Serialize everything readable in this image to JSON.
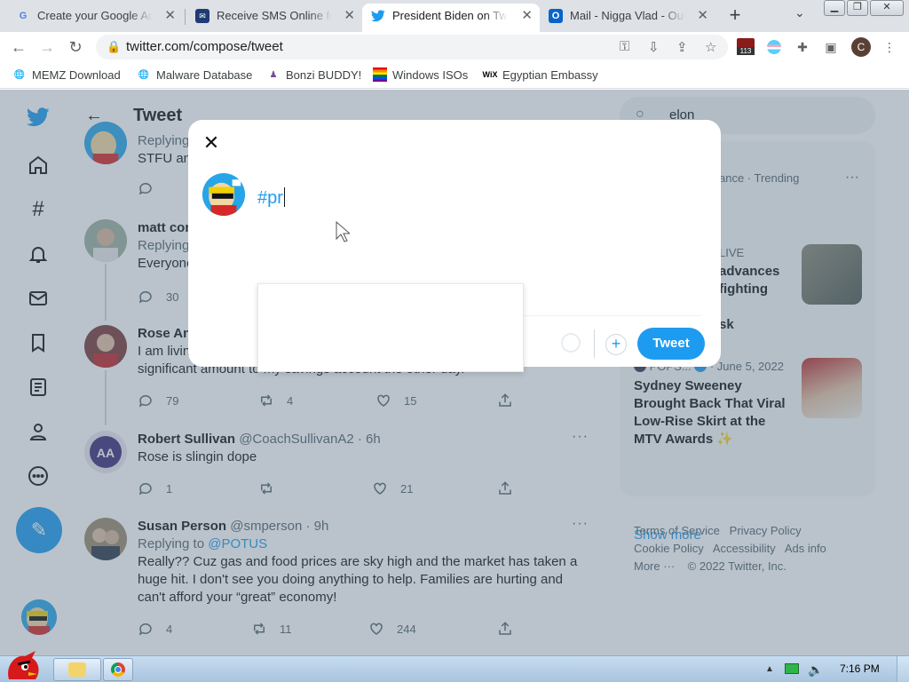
{
  "browser": {
    "tabs": [
      {
        "title": "Create your Google Acc",
        "favicon": "G"
      },
      {
        "title": "Receive SMS Online for",
        "favicon": "sms"
      },
      {
        "title": "President Biden on Twit",
        "favicon": "twitter"
      },
      {
        "title": "Mail - Nigga Vlad - Out",
        "favicon": "outlook"
      }
    ],
    "url": "twitter.com/compose/tweet",
    "profile_initial": "C",
    "extension_badge": "113",
    "bookmarks": [
      "MEMZ Download",
      "Malware Database",
      "Bonzi BUDDY!",
      "Windows ISOs",
      "Egyptian Embassy"
    ]
  },
  "twitter": {
    "header_title": "Tweet",
    "tweets": [
      {
        "replying": "Replying",
        "text": "STFU an"
      },
      {
        "name": "matt cor",
        "replying": "Replying",
        "text": "Everyone",
        "replies": "30"
      },
      {
        "name": "Rose An",
        "text_line1": "I am livin",
        "text_line2": "significant amount to my savings account the other day.",
        "replies": "79",
        "retweets": "4",
        "likes": "15"
      },
      {
        "name": "Robert Sullivan",
        "handle": "@CoachSullivanA2 · 6h",
        "text": "Rose is slingin dope",
        "replies": "1",
        "likes": "21"
      },
      {
        "name": "Susan Person",
        "handle": "@smperson · 9h",
        "replying_prefix": "Replying to",
        "replying_to": "@POTUS",
        "text": "Really?? Cuz gas and food prices are sky high and the market has taken a huge hit.  I don't see you doing anything to help.  Families are hurting and can't afford your “great” economy!",
        "replies": "4",
        "retweets": "11",
        "likes": "244"
      }
    ],
    "search_query": "elon",
    "trends": [
      {
        "meta": "ance · Trending"
      },
      {
        "meta": "LIVE",
        "title_line1": "advances",
        "title_line2": "fighting"
      },
      {
        "title": "sk"
      },
      {
        "source": "POPS...",
        "date": "· June 5, 2022",
        "title": "Sydney Sweeney Brought Back That Viral Low-Rise Skirt at the MTV Awards ✨"
      }
    ],
    "show_more": "Show more",
    "footer": {
      "line1": [
        "Terms of Service",
        "Privacy Policy"
      ],
      "line2": [
        "Cookie Policy",
        "Accessibility",
        "Ads info"
      ],
      "line3": [
        "More ···",
        "© 2022 Twitter, Inc."
      ]
    }
  },
  "compose": {
    "text": "#pr",
    "tweet_button": "Tweet"
  },
  "taskbar": {
    "time": "7:16 PM"
  },
  "colors": {
    "twitter_blue": "#1d9bf0",
    "text_primary": "#0f1419",
    "text_secondary": "#536471"
  }
}
